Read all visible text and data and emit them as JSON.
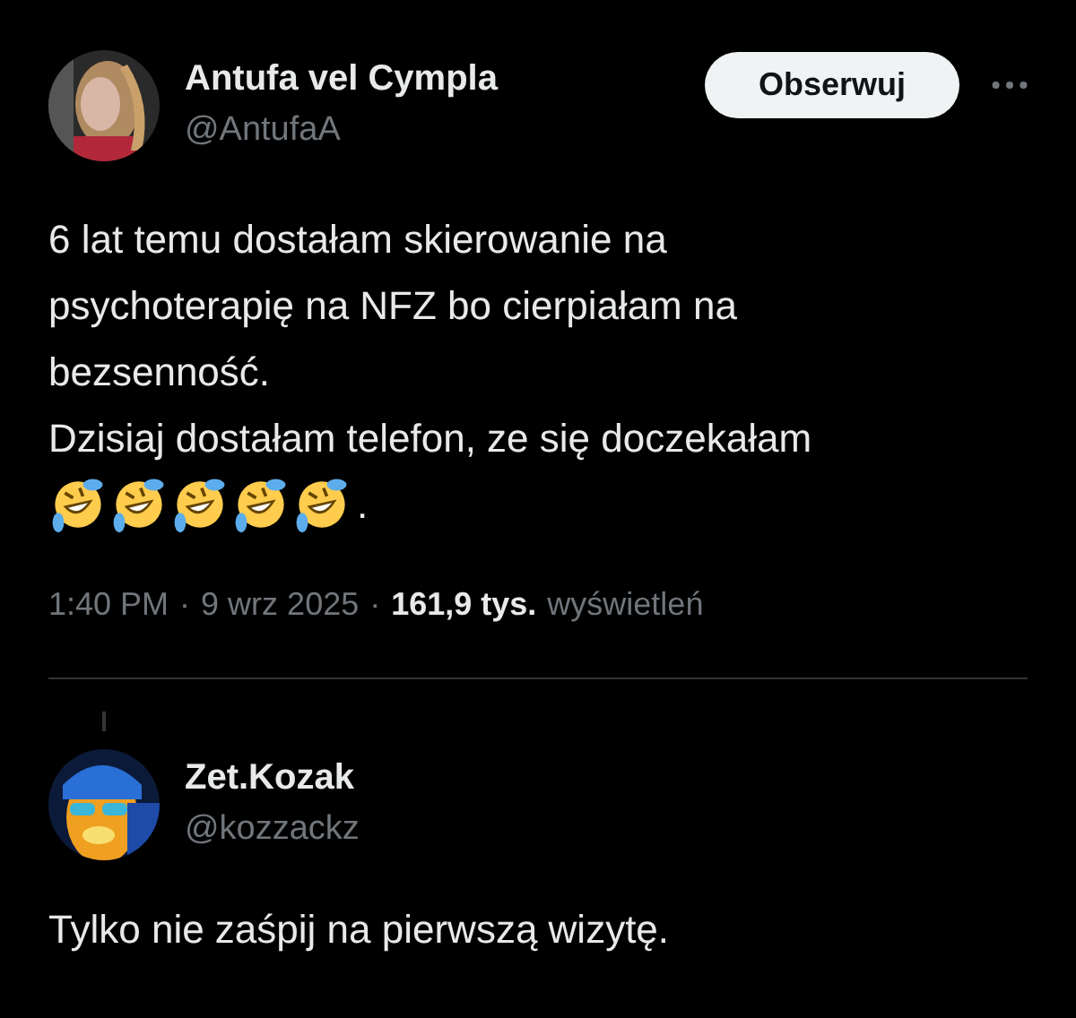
{
  "tweet": {
    "author": {
      "name": "Antufa vel Cympla",
      "handle": "@AntufaA"
    },
    "follow_button": "Obserwuj",
    "lines": [
      "6 lat temu dostałam skierowanie na",
      "psychoterapię na NFZ bo cierpiałam na",
      "bezsenność.",
      "Dzisiaj dostałam telefon, ze się doczekałam"
    ],
    "emojis": [
      {
        "kind": "rolling-laughing"
      },
      {
        "kind": "rolling-laughing"
      },
      {
        "kind": "rolling-laughing"
      },
      {
        "kind": "rolling-laughing"
      },
      {
        "kind": "rolling-laughing"
      }
    ],
    "after_emojis": ".",
    "time": "1:40 PM",
    "separator_1": "·",
    "date": "9 wrz 2025",
    "separator_2": "·",
    "views_count": "161,9 tys.",
    "views_label": "wyświetleń"
  },
  "reply": {
    "author": {
      "name": "Zet.Kozak",
      "handle": "@kozzackz"
    },
    "text": "Tylko nie zaśpij na pierwszą wizytę."
  }
}
